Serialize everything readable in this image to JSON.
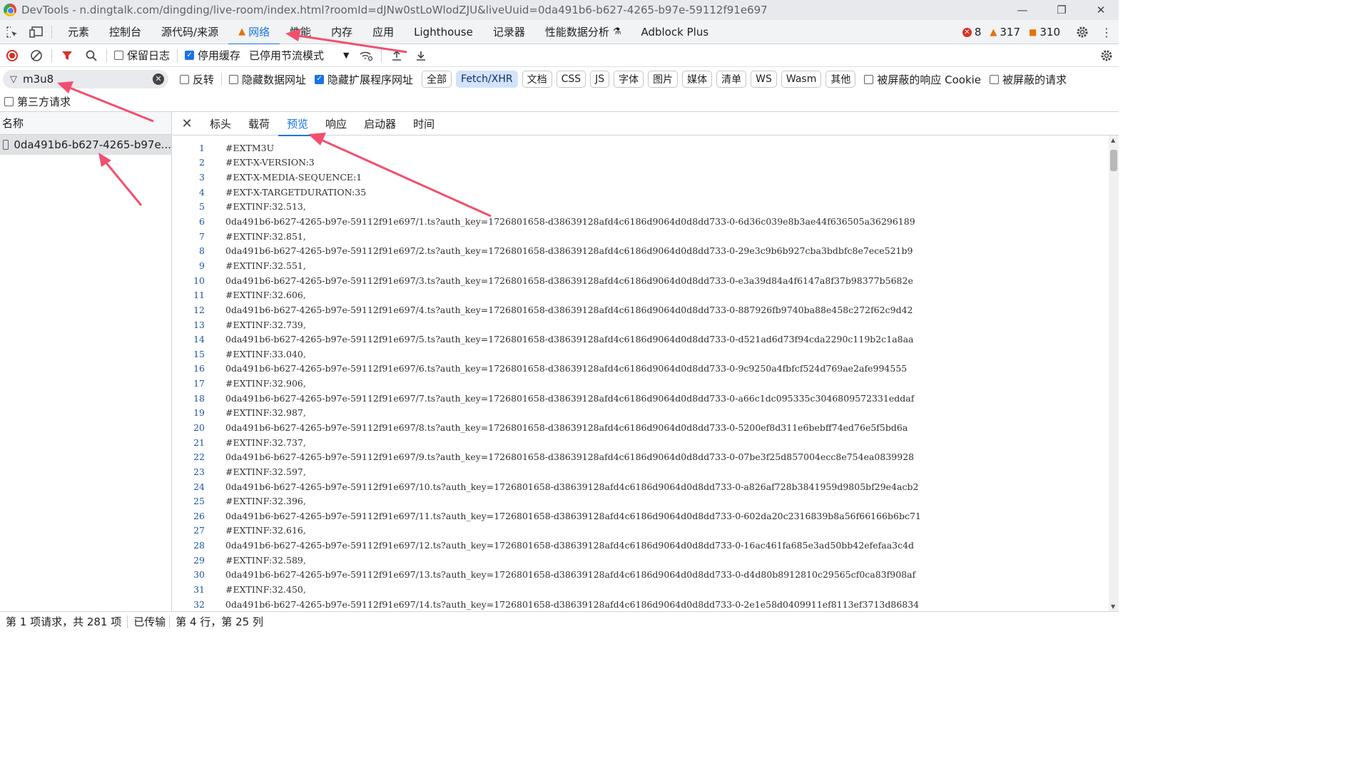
{
  "window": {
    "title": "DevTools - n.dingtalk.com/dingding/live-room/index.html?roomId=dJNw0stLoWlodZJU&liveUuid=0da491b6-b627-4265-b97e-59112f91e697",
    "minimize": "—",
    "restore": "❐",
    "close": "✕"
  },
  "panel_tabs": [
    "元素",
    "控制台",
    "源代码/来源",
    "网络",
    "性能",
    "内存",
    "应用",
    "Lighthouse",
    "记录器",
    "性能数据分析",
    "Adblock Plus"
  ],
  "counts": {
    "errors": "8",
    "warnings": "317",
    "messages": "310"
  },
  "toolbar": {
    "preserve_log": "保留日志",
    "disable_cache": "停用缓存",
    "throttle": "已停用节流模式"
  },
  "filter": {
    "value": "m3u8",
    "invert": "反转",
    "hide_data_urls": "隐藏数据网址",
    "hide_ext_urls": "隐藏扩展程序网址",
    "types": [
      "全部",
      "Fetch/XHR",
      "文档",
      "CSS",
      "JS",
      "字体",
      "图片",
      "媒体",
      "清单",
      "WS",
      "Wasm",
      "其他"
    ],
    "blocked_cookies": "被屏蔽的响应 Cookie",
    "blocked_requests": "被屏蔽的请求",
    "third_party": "第三方请求"
  },
  "requests": {
    "header": "名称",
    "items": [
      "0da491b6-b627-4265-b97e..."
    ]
  },
  "detail_tabs": [
    "标头",
    "载荷",
    "预览",
    "响应",
    "启动器",
    "时间"
  ],
  "preview_lines": [
    "#EXTM3U",
    "#EXT-X-VERSION:3",
    "#EXT-X-MEDIA-SEQUENCE:1",
    "#EXT-X-TARGETDURATION:35",
    "#EXTINF:32.513,",
    "0da491b6-b627-4265-b97e-59112f91e697/1.ts?auth_key=1726801658-d38639128afd4c6186d9064d0d8dd733-0-6d36c039e8b3ae44f636505a36296189",
    "#EXTINF:32.851,",
    "0da491b6-b627-4265-b97e-59112f91e697/2.ts?auth_key=1726801658-d38639128afd4c6186d9064d0d8dd733-0-29e3c9b6b927cba3bdbfc8e7ece521b9",
    "#EXTINF:32.551,",
    "0da491b6-b627-4265-b97e-59112f91e697/3.ts?auth_key=1726801658-d38639128afd4c6186d9064d0d8dd733-0-e3a39d84a4f6147a8f37b98377b5682e",
    "#EXTINF:32.606,",
    "0da491b6-b627-4265-b97e-59112f91e697/4.ts?auth_key=1726801658-d38639128afd4c6186d9064d0d8dd733-0-887926fb9740ba88e458c272f62c9d42",
    "#EXTINF:32.739,",
    "0da491b6-b627-4265-b97e-59112f91e697/5.ts?auth_key=1726801658-d38639128afd4c6186d9064d0d8dd733-0-d521ad6d73f94cda2290c119b2c1a8aa",
    "#EXTINF:33.040,",
    "0da491b6-b627-4265-b97e-59112f91e697/6.ts?auth_key=1726801658-d38639128afd4c6186d9064d0d8dd733-0-9c9250a4fbfcf524d769ae2afe994555",
    "#EXTINF:32.906,",
    "0da491b6-b627-4265-b97e-59112f91e697/7.ts?auth_key=1726801658-d38639128afd4c6186d9064d0d8dd733-0-a66c1dc095335c3046809572331eddaf",
    "#EXTINF:32.987,",
    "0da491b6-b627-4265-b97e-59112f91e697/8.ts?auth_key=1726801658-d38639128afd4c6186d9064d0d8dd733-0-5200ef8d311e6bebff74ed76e5f5bd6a",
    "#EXTINF:32.737,",
    "0da491b6-b627-4265-b97e-59112f91e697/9.ts?auth_key=1726801658-d38639128afd4c6186d9064d0d8dd733-0-07be3f25d857004ecc8e754ea0839928",
    "#EXTINF:32.597,",
    "0da491b6-b627-4265-b97e-59112f91e697/10.ts?auth_key=1726801658-d38639128afd4c6186d9064d0d8dd733-0-a826af728b3841959d9805bf29e4acb2",
    "#EXTINF:32.396,",
    "0da491b6-b627-4265-b97e-59112f91e697/11.ts?auth_key=1726801658-d38639128afd4c6186d9064d0d8dd733-0-602da20c2316839b8a56f66166b6bc71",
    "#EXTINF:32.616,",
    "0da491b6-b627-4265-b97e-59112f91e697/12.ts?auth_key=1726801658-d38639128afd4c6186d9064d0d8dd733-0-16ac461fa685e3ad50bb42efefaa3c4d",
    "#EXTINF:32.589,",
    "0da491b6-b627-4265-b97e-59112f91e697/13.ts?auth_key=1726801658-d38639128afd4c6186d9064d0d8dd733-0-d4d80b8912810c29565cf0ca83f908af",
    "#EXTINF:32.450,",
    "0da491b6-b627-4265-b97e-59112f91e697/14.ts?auth_key=1726801658-d38639128afd4c6186d9064d0d8dd733-0-2e1e58d0409911ef8113ef3713d86834"
  ],
  "status": {
    "requests": "第 1 项请求，共 281 项",
    "transferred": "已传输",
    "cursor": "第 4 行，第 25 列"
  },
  "colors": {
    "accent": "#1a73e8",
    "annotation_arrow": "#f0506e",
    "record": "#d93025"
  }
}
